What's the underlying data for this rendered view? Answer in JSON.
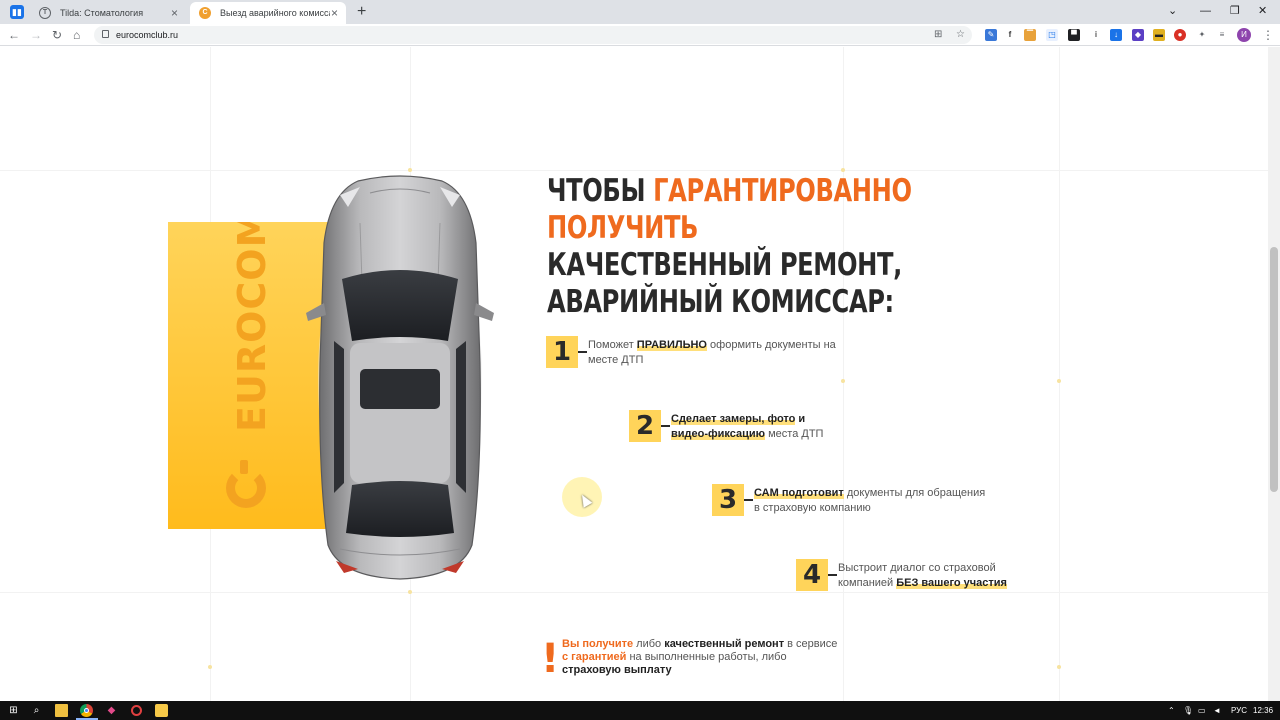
{
  "browser": {
    "tabs": [
      {
        "title": "Tilda: Стоматология",
        "icon": "tilda-icon",
        "active": false
      },
      {
        "title": "Выезд аварийного комиссара п",
        "icon": "eurocom-favicon",
        "active": true
      }
    ],
    "url": "eurocomclub.ru",
    "avatar_initial": "И"
  },
  "brand": {
    "name": "EUROCOM",
    "primary_color": "#ffc22e",
    "accent_color": "#ef6a1e"
  },
  "headline": {
    "part1": "ЧТОБЫ ",
    "highlight": "ГАРАНТИРОВАННО ПОЛУЧИТЬ",
    "part2": "КАЧЕСТВЕННЫЙ РЕМОНТ, АВАРИЙНЫЙ КОМИССАР:"
  },
  "steps": [
    {
      "num": "1",
      "pre": "Поможет ",
      "bold": "ПРАВИЛЬНО",
      "post": " оформить документы на месте ДТП"
    },
    {
      "num": "2",
      "bold1": "Сделает замеры, фото",
      "mid": " и ",
      "bold2": "видео-фиксацию",
      "post": " места ДТП"
    },
    {
      "num": "3",
      "bold": "САМ подготовит",
      "post": " документы для обращения в страховую компанию"
    },
    {
      "num": "4",
      "pre": "Выстроит диалог со страховой компанией ",
      "bold": "БЕЗ вашего участия"
    }
  ],
  "note": {
    "mark": "!",
    "orange1": "Вы получите",
    "t1": " либо ",
    "bold1": "качественный ремонт",
    "t2": " в сервисе ",
    "orange2": "с гарантией",
    "t3": " на выполненные работы, либо ",
    "bold2": "страховую выплату"
  },
  "taskbar": {
    "lang": "РУС",
    "time": "12:36"
  }
}
